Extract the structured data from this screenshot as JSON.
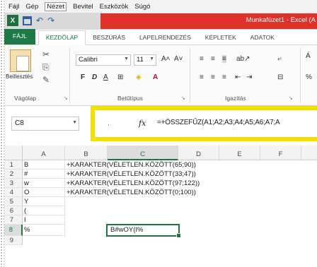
{
  "menubar": {
    "items": [
      "Fájl",
      "Gép",
      "Nézet",
      "Bevitel",
      "Eszközök",
      "Súgó"
    ]
  },
  "window": {
    "title": "Munkafüzet1 - Excel (A"
  },
  "quick_access": {
    "logo": "X",
    "undo": "↶",
    "redo": "↷"
  },
  "ribbon_tabs": [
    "FÁJL",
    "KEZDŐLAP",
    "BESZÚRÁS",
    "LAPELRENDEZÉS",
    "KÉPLETEK",
    "ADATOK"
  ],
  "ribbon": {
    "paste_label": "Beillesztés",
    "font_name": "Calibri",
    "font_size": "11",
    "groups": [
      "Vágólap",
      "Betűtípus",
      "Igazítás"
    ],
    "font_buttons": [
      "F",
      "D",
      "A"
    ]
  },
  "formula_bar": {
    "name_box": "C8",
    "fx": "fx",
    "formula": "=+ÖSSZEFŰZ(A1;A2;A3;A4;A5;A6;A7;A"
  },
  "grid": {
    "columns": [
      "A",
      "B",
      "C",
      "D",
      "E",
      "F"
    ],
    "rows": [
      "1",
      "2",
      "3",
      "4",
      "5",
      "6",
      "7",
      "8",
      "9"
    ],
    "col_a": [
      "B",
      "#",
      "w",
      "O",
      "Y",
      "(",
      "I",
      "%",
      ""
    ],
    "col_b": [
      "+KARAKTER(VÉLETLEN.KÖZÖTT(65;90))",
      "+KARAKTER(VÉLETLEN.KÖZÖTT(33;47))",
      "+KARAKTER(VÉLETLEN.KÖZÖTT(97;122))",
      "+KARAKTER(VÉLETLEN.KÖZÖTT(0;100))"
    ],
    "active_cell_value": "B#wOY(I%"
  },
  "colors": {
    "excel_green": "#217346",
    "title_red": "#e0302a",
    "highlight_yellow": "#f2e000"
  }
}
